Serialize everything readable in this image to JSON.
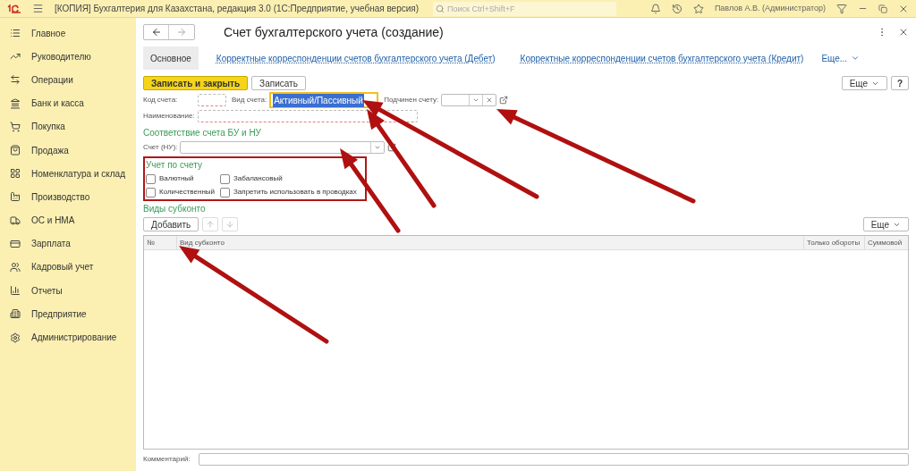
{
  "topbar": {
    "title": "[КОПИЯ] Бухгалтерия для Казахстана, редакция 3.0  (1С:Предприятие, учебная версия)",
    "search": {
      "placeholder": "Поиск Ctrl+Shift+F"
    },
    "user": "Павлов А.В. (Администратор)"
  },
  "sidebar": {
    "items": [
      {
        "label": "Главное"
      },
      {
        "label": "Руководителю"
      },
      {
        "label": "Операции"
      },
      {
        "label": "Банк и касса"
      },
      {
        "label": "Покупка"
      },
      {
        "label": "Продажа"
      },
      {
        "label": "Номенклатура и склад"
      },
      {
        "label": "Производство"
      },
      {
        "label": "ОС и НМА"
      },
      {
        "label": "Зарплата"
      },
      {
        "label": "Кадровый учет"
      },
      {
        "label": "Отчеты"
      },
      {
        "label": "Предприятие"
      },
      {
        "label": "Администрирование"
      }
    ]
  },
  "form": {
    "title": "Счет бухгалтерского учета (создание)",
    "tabs": [
      {
        "label": "Основное",
        "selected": true
      },
      {
        "label": "Корректные корреспонденции счетов бухгалтерского учета (Дебет)",
        "selected": false
      },
      {
        "label": "Корректные корреспонденции счетов бухгалтерского учета (Кредит)",
        "selected": false
      }
    ],
    "tabs_more": "Еще...",
    "buttons": {
      "primary": "Записать и закрыть",
      "secondary": "Записать",
      "more": "Еще",
      "help": "?"
    },
    "code_label": "Код счета:",
    "type_label": "Вид счета:",
    "type_value": "Активный/Пассивный",
    "parent_label": "Подчинен счету:",
    "name_label": "Наименование:",
    "tax_section": "Соответствие счета БУ и НУ",
    "tax_label": "Счет (НУ):",
    "accounting_section": "Учет по счету",
    "flags": [
      {
        "label": "Валютный",
        "checked": false
      },
      {
        "label": "Забалансовый",
        "checked": false
      },
      {
        "label": "Количественный",
        "checked": false
      },
      {
        "label": "Запретить использовать в проводках",
        "checked": false
      }
    ],
    "subconto_section": "Виды субконто",
    "add_button": "Добавить",
    "table_more": "Еще",
    "columns": [
      "№",
      "Вид субконто",
      "Только обороты",
      "Суммовой"
    ],
    "comment_label": "Комментарий:"
  }
}
